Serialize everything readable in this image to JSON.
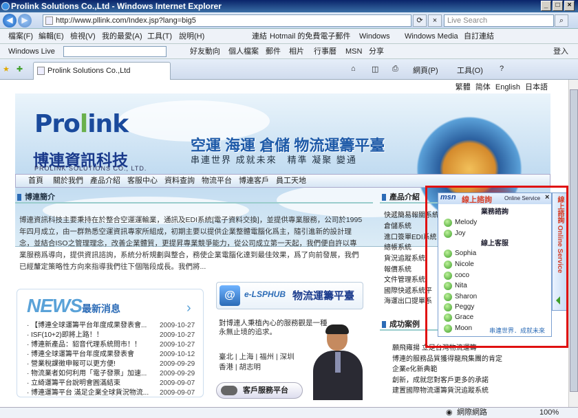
{
  "window_title": "Prolink Solutions Co.,Ltd - Windows Internet Explorer",
  "address": "http://www.pllink.com/Index.jsp?lang=big5",
  "search_placeholder": "Live Search",
  "menu": {
    "items": [
      "檔案(F)",
      "編輯(E)",
      "檢視(V)",
      "我的最愛(A)",
      "工具(T)",
      "說明(H)"
    ],
    "links_label": "連結",
    "favs": [
      "Hotmail 的免費電子郵件",
      "Windows",
      "Windows Media",
      "自訂連結"
    ]
  },
  "wl": {
    "label": "Windows Live",
    "items": [
      "好友動向",
      "個人檔案",
      "郵件",
      "相片",
      "行事曆",
      "MSN",
      "分享"
    ],
    "signin": "登入"
  },
  "tab": {
    "title": "Prolink Solutions Co.,Ltd",
    "tools": [
      "網頁(P)",
      "工具(O)"
    ]
  },
  "status": {
    "zone": "網際網路",
    "zoom": "100%"
  },
  "lang": [
    "繁體",
    "简体",
    "English",
    "日本語"
  ],
  "banner": {
    "logo_a": "Pro",
    "logo_b": "l",
    "logo_c": "ink",
    "cname": "博連資訊科技",
    "ename": "PROLINK SOLUTIONS CO., LTD.",
    "slogan1": "空運 海運 倉儲 物流運籌平臺",
    "slogan2": "串連世界 成就未來　精準 凝聚 變通"
  },
  "nav": [
    "首頁",
    "關於我們",
    "產品介紹",
    "客服中心",
    "資料查詢",
    "物流平台",
    "博連客戶",
    "員工天地"
  ],
  "intro": {
    "title": "博連簡介",
    "text": "博連資訊科技主要秉持在於整合空運運輸業，通訊及EDI系統[電子資料交換]，並提供專業服務，公司於1995年四月成立，由一群熟悉空運資訊專家所組成，初期主要以提供企業整體電腦化爲主，隨引進新的設計理念，並結合ISO之管理理念，改善企業體質，更提昇專業競爭能力，從公司成立第一天起，我們便自許以專業服務爲導向，提供資訊諮詢，系統分析規劃與整合，務使企業電腦化達到最佳效果，爲了向前發展，我們已經釐定策略性方向來指導我們往下個階段成長。我們將..."
  },
  "news": {
    "title_a": "NEWS",
    "title_b": "最新消息",
    "arrow": "›",
    "rows": [
      {
        "t": "【博連全球運籌平台年度成果發表會...",
        "d": "2009-10-27"
      },
      {
        "t": "ISF(10+2)即將上路！！",
        "d": "2009-10-27"
      },
      {
        "t": "博連新產品：貂音代理系統問市！！",
        "d": "2009-10-27"
      },
      {
        "t": "博連全球運籌平台年度成果發表會",
        "d": "2009-10-12"
      },
      {
        "t": "營業稅課徵申報可以更方便!",
        "d": "2009-09-29"
      },
      {
        "t": "物流業者如何利用「電子發票」加速...",
        "d": "2009-09-29"
      },
      {
        "t": "立綺運籌平台說明會圓滿結束",
        "d": "2009-09-07"
      },
      {
        "t": "博連運籌平台 滿足企業全球貨況物流...",
        "d": "2009-09-07"
      }
    ]
  },
  "lsp": {
    "icon": "@",
    "a": "e-LSPHUB",
    "b": "物流運籌平臺"
  },
  "quote": [
    "對博連人秉植內心的服務觀是一種",
    "永無止境的追求。"
  ],
  "offices": [
    "臺北 | 上海 | 福州 | 深圳",
    "香港 | 胡志明"
  ],
  "svc_label": "客戶服務平台",
  "products": {
    "title": "產品介紹",
    "items": [
      "快遞簡易報關系統",
      "倉儲系統",
      "進口簽單EDI系統",
      "總帳系統",
      "貨況追蹤系統",
      "報價系統",
      "文件管理系統",
      "國際快遞系統平",
      "海運出口提單系"
    ]
  },
  "cases": {
    "title": "成功案例",
    "items": [
      "願飛雍揚 立足台灣物流運籌",
      "博連的服務品質獲得龍飛集團的肯定",
      "企業e化新典範",
      "創新，成就您對客戶更多的承諾",
      "建置國際物流運籌貨況追蹤系統"
    ]
  },
  "msn": {
    "brand": "msn",
    "title": "線上諮詢",
    "online": "Online Service",
    "close": "×",
    "groups": [
      {
        "name": "業務諮詢",
        "buddies": [
          "Melody",
          "Joy"
        ]
      },
      {
        "name": "線上客服",
        "buddies": [
          "Sophia",
          "Nicole",
          "coco",
          "Nita",
          "Sharon",
          "Peggy",
          "Grace",
          "Moon"
        ]
      }
    ],
    "footer": "串連世界．成就未來",
    "side": "線上諮詢 Online Service"
  },
  "colors": {
    "accent": "#2b6bb6",
    "highlight": "#e01010",
    "msn_red": "#d6402a"
  }
}
